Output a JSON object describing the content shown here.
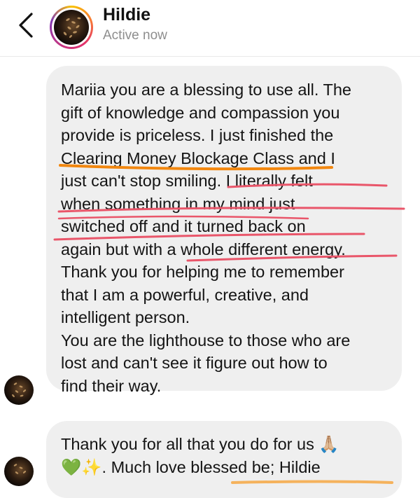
{
  "header": {
    "name": "Hildie",
    "status": "Active now"
  },
  "messages": [
    {
      "lines": [
        "Mariia you are a blessing to use all. The",
        "gift of knowledge and compassion you",
        "provide is priceless. I just finished the",
        "Clearing Money Blockage Class and I",
        "just can't stop smiling. I literally felt",
        "when something in my mind just",
        "switched off and it turned back on",
        "again but with a whole different energy.",
        "Thank you for helping me to remember",
        "that I am a powerful, creative, and",
        "intelligent person.",
        "You are the lighthouse to those who are",
        "lost and can't see it figure out how to",
        "find their way."
      ]
    },
    {
      "lines": [
        "Thank you for all that you do for us 🙏🏼",
        "💚✨. Much love blessed be; Hildie"
      ]
    }
  ],
  "icons": {
    "back": "chevron-left-icon",
    "avatar": "profile-avatar"
  },
  "colors": {
    "bubble": "#efefef",
    "orange_highlight": "#f2870f",
    "red_underline": "#e9566a",
    "status_text": "#8e8e8e"
  }
}
